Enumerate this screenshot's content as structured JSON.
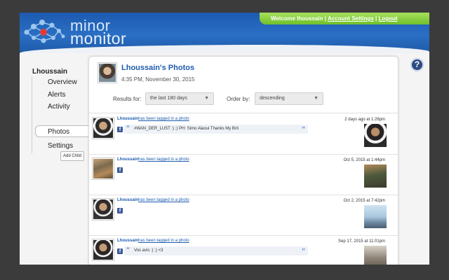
{
  "header": {
    "logo_line1": "minor",
    "logo_line2": "monitor",
    "welcome_text": "Welcome lhoussain",
    "separator": "|",
    "account_settings": "Account Settings",
    "logout": "Logout"
  },
  "sidebar": {
    "user_name": "Lhoussain",
    "items": [
      {
        "label": "Overview"
      },
      {
        "label": "Alerts"
      },
      {
        "label": "Activity"
      },
      {
        "label": "Photos"
      },
      {
        "label": "Settings"
      }
    ],
    "add_child_label": "Add Child"
  },
  "help": {
    "label": "?"
  },
  "main": {
    "title": "Lhoussain's Photos",
    "timestamp": "4:35 PM, November 30, 2015",
    "results_label": "Results for:",
    "results_value": "the last 180 days",
    "order_label": "Order by:",
    "order_value": "descending",
    "rows": [
      {
        "name": "Lhoussain",
        "action": "has been tagged in a photo",
        "date": "2 days ago at 1:26pm",
        "caption": "#WAN_DER_LUST :) ;) PH: Simo Alaoui Thanks My Brô"
      },
      {
        "name": "Lhoussain",
        "action": "has been tagged in a photo",
        "date": "Oct 5, 2015 at 1:44pm",
        "caption": ""
      },
      {
        "name": "Lhoussain",
        "action": "has been tagged in a photo",
        "date": "Oct 2, 2015 at 7:42pm",
        "caption": ""
      },
      {
        "name": "Lhoussain",
        "action": "has been tagged in a photo",
        "date": "Sep 17, 2015 at 11:01pm",
        "caption": "Vos avis :) ;) <3"
      }
    ]
  },
  "colors": {
    "brand_blue": "#1d5cae",
    "header_blue": "#2a6fc4",
    "welcome_green": "#6fc02a",
    "facebook_blue": "#3b5998"
  }
}
